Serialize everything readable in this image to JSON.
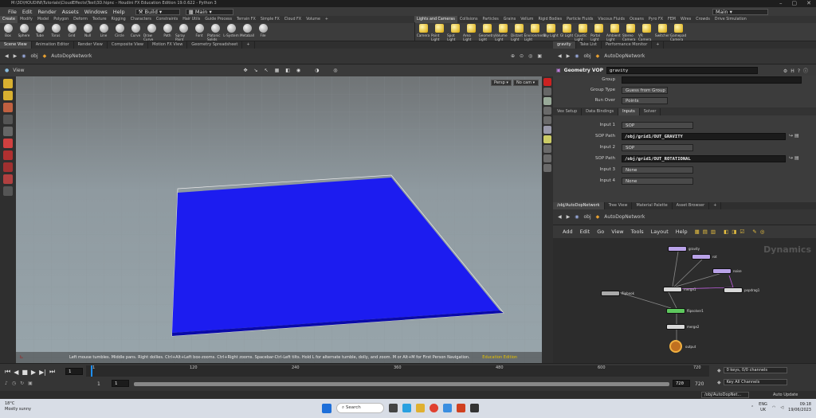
{
  "window": {
    "title": "M:\\3D\\HOUDINI\\Tutorials\\CloudEffects\\Test\\3D.hipnc - Houdini FX Education Edition 19.0.622 - Python 3"
  },
  "menubar": {
    "items": [
      "File",
      "Edit",
      "Render",
      "Assets",
      "Windows",
      "Help"
    ],
    "build_label": "Build",
    "desktop_label": "Main",
    "main_right": "Main"
  },
  "shelf_left": {
    "tabs": [
      "Create",
      "Modify",
      "Model",
      "Polygon",
      "Deform",
      "Texture",
      "Rigging",
      "Characters",
      "Constraints",
      "Hair Utils",
      "Guide Process",
      "Terrain FX",
      "Simple FX",
      "Cloud FX",
      "Volume"
    ],
    "tools": [
      "Box",
      "Sphere",
      "Tube",
      "Torus",
      "Grid",
      "Null",
      "Line",
      "Circle",
      "Curve",
      "Draw Curve",
      "Path",
      "Spray Paint",
      "Font",
      "Platonic Solids",
      "L-System",
      "Metaball",
      "File"
    ]
  },
  "shelf_right": {
    "tabs": [
      "Lights and Cameras",
      "Collisions",
      "Particles",
      "Grains",
      "Vellum",
      "Rigid Bodies",
      "Particle Fluids",
      "Viscous Fluids",
      "Oceans",
      "Pyro FX",
      "FEM",
      "Wires",
      "Crowds",
      "Drive Simulation"
    ],
    "tools": [
      "Camera",
      "Point Light",
      "Spot Light",
      "Area Light",
      "Geometry Light",
      "Volume Light",
      "Distant Light",
      "Environment Light",
      "Sky Light",
      "GI Light",
      "Caustic Light",
      "Portal Light",
      "Ambient Light",
      "Stereo Camera",
      "VR Camera",
      "Switcher",
      "Gamepad Camera"
    ]
  },
  "scene_panel": {
    "tabs": [
      "Scene View",
      "Animation Editor",
      "Render View",
      "Composite View",
      "Motion FX View",
      "Geometry Spreadsheet"
    ],
    "path_obj": "obj",
    "path_net": "AutoDopNetwork",
    "view_label": "View",
    "persp": "Persp",
    "cam": "No cam",
    "status": "Left mouse tumbles. Middle pans. Right dollies. Ctrl+Alt+Left box-zooms. Ctrl+Right zooms. Spacebar-Ctrl-Left tilts. Hold L for alternate tumble, dolly, and zoom.   M or Alt+M for First Person Navigation.",
    "edition": "Education Edition"
  },
  "parm_panel": {
    "tabs": [
      "gravity",
      "Take List",
      "Performance Monitor"
    ],
    "path_obj": "obj",
    "path_net": "AutoDopNetwork",
    "node_type": "Geometry VOP",
    "node_name": "gravity",
    "subtabs": [
      "Vex Setup",
      "Data Bindings",
      "Inputs",
      "Solver"
    ],
    "rows": [
      {
        "label": "Group",
        "value": "",
        "kind": "field"
      },
      {
        "label": "Group Type",
        "value": "Guess from Group",
        "kind": "combo"
      },
      {
        "label": "Run Over",
        "value": "Points",
        "kind": "combo"
      },
      {
        "label": "Input 1",
        "value": "SOP",
        "kind": "combo"
      },
      {
        "label": "SOP Path",
        "value": "/obj/grid1/OUT_GRAVITY",
        "kind": "field"
      },
      {
        "label": "Input 2",
        "value": "SOP",
        "kind": "combo"
      },
      {
        "label": "SOP Path",
        "value": "/obj/grid1/OUT_ROTATIONAL",
        "kind": "field"
      },
      {
        "label": "Input 3",
        "value": "None",
        "kind": "combo"
      },
      {
        "label": "Input 4",
        "value": "None",
        "kind": "combo"
      }
    ]
  },
  "network_panel": {
    "tabs": [
      "/obj/AutoDopNetwork",
      "Tree View",
      "Material Palette",
      "Asset Browser"
    ],
    "path_obj": "obj",
    "path_net": "AutoDopNetwork",
    "menu": [
      "Add",
      "Edit",
      "Go",
      "View",
      "Tools",
      "Layout",
      "Help"
    ],
    "context": "Dynamics",
    "nodes": [
      "gravity",
      "rot",
      "noise",
      "merge1",
      "popdrag1",
      "flipbook",
      "flipsolver1",
      "merge2",
      "output"
    ]
  },
  "playbar": {
    "frame": "1",
    "start": "1",
    "end": "720",
    "end2": "720",
    "ticks": [
      "1",
      "120",
      "240",
      "360",
      "480",
      "600",
      "720"
    ],
    "keys_info": "0 keys, 0/0 channels",
    "key_all": "Key All Channels",
    "net_path": "/obj/AutoDopNet...",
    "auto_update": "Auto Update"
  },
  "taskbar": {
    "temp": "18°C",
    "weather": "Mostly sunny",
    "search": "Search",
    "lang": "ENG",
    "region": "UK",
    "time": "09:18",
    "date": "19/06/2023"
  }
}
